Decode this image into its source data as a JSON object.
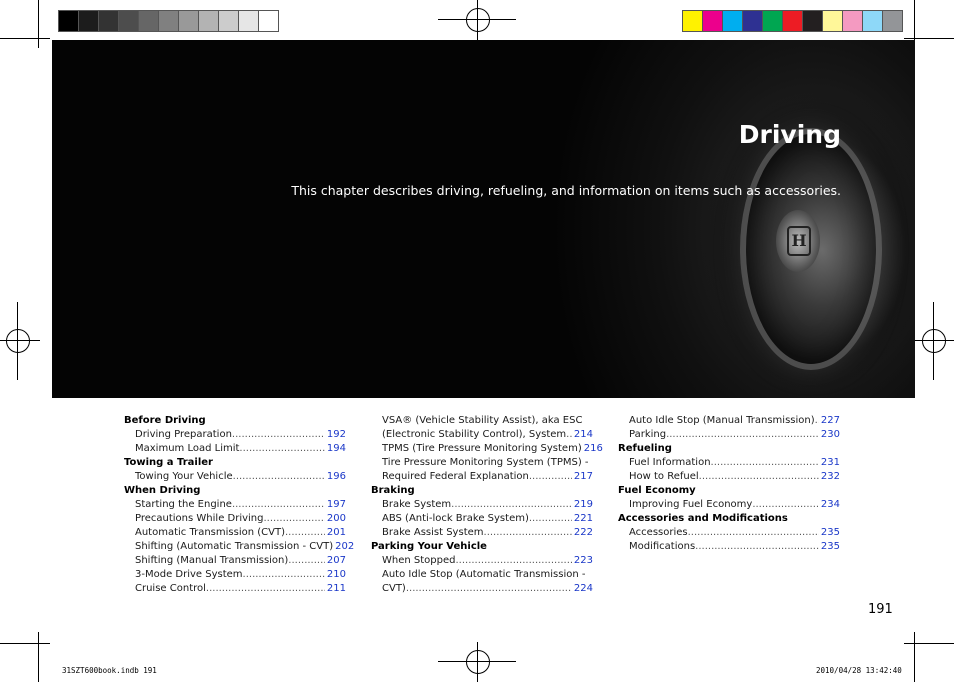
{
  "swatch_colors": {
    "gray": [
      "#000000",
      "#1c1c1c",
      "#333333",
      "#4d4d4d",
      "#666666",
      "#808080",
      "#999999",
      "#b3b3b3",
      "#cccccc",
      "#e6e6e6",
      "#ffffff"
    ],
    "process": [
      "#fff200",
      "#ec008c",
      "#00aeef",
      "#2e3192",
      "#00a651",
      "#ed1c24",
      "#231f20",
      "#fff799",
      "#f49ac1",
      "#8ed8f8",
      "#939598"
    ]
  },
  "hero": {
    "title": "Driving",
    "description": "This chapter describes driving, refueling, and information on items such as accessories.",
    "logo_glyph": "H"
  },
  "toc": {
    "col1": {
      "before_driving": "Before Driving",
      "driving_prep": {
        "label": "Driving Preparation",
        "page": "192"
      },
      "max_load": {
        "label": "Maximum Load Limit",
        "page": "194"
      },
      "towing_trailer": "Towing a Trailer",
      "towing_vehicle": {
        "label": "Towing Your Vehicle",
        "page": "196"
      },
      "when_driving": "When Driving",
      "starting_engine": {
        "label": "Starting the Engine",
        "page": "197"
      },
      "precautions": {
        "label": "Precautions While Driving",
        "page": "200"
      },
      "auto_cvt": {
        "label": "Automatic Transmission (CVT)",
        "page": "201"
      },
      "shift_auto": {
        "label": "Shifting (Automatic Transmission - CVT)",
        "page": "202"
      },
      "shift_manual": {
        "label": "Shifting (Manual Transmission)",
        "page": "207"
      },
      "three_mode": {
        "label": "3-Mode Drive System",
        "page": "210"
      },
      "cruise": {
        "label": "Cruise Control",
        "page": "211"
      }
    },
    "col2": {
      "vsa_line1": "VSA® (Vehicle Stability Assist), aka ESC",
      "vsa_line2": {
        "label": "(Electronic Stability Control), System",
        "page": "214"
      },
      "tpms1": {
        "label": "TPMS (Tire Pressure Monitoring System)",
        "page": "216"
      },
      "tpms2_line1": "Tire Pressure Monitoring System (TPMS) -",
      "tpms2_line2": {
        "label": "Required Federal Explanation",
        "page": "217"
      },
      "braking": "Braking",
      "brake_system": {
        "label": "Brake System",
        "page": "219"
      },
      "abs": {
        "label": "ABS (Anti-lock Brake System)",
        "page": "221"
      },
      "brake_assist": {
        "label": "Brake Assist System",
        "page": "222"
      },
      "parking": "Parking Your Vehicle",
      "when_stopped": {
        "label": "When Stopped",
        "page": "223"
      },
      "idle_auto_line1": "Auto Idle Stop (Automatic Transmission -",
      "idle_auto_line2": {
        "label": "CVT)",
        "page": "224"
      }
    },
    "col3": {
      "idle_manual": {
        "label": "Auto Idle Stop (Manual Transmission)",
        "page": "227"
      },
      "parking_item": {
        "label": "Parking",
        "page": "230"
      },
      "refueling": "Refueling",
      "fuel_info": {
        "label": "Fuel Information",
        "page": "231"
      },
      "how_refuel": {
        "label": "How to Refuel",
        "page": "232"
      },
      "fuel_economy": "Fuel Economy",
      "improving": {
        "label": "Improving Fuel Economy",
        "page": "234"
      },
      "acc_mods": "Accessories and Modifications",
      "accessories": {
        "label": "Accessories",
        "page": "235"
      },
      "modifications": {
        "label": "Modifications",
        "page": "235"
      }
    }
  },
  "page_number": "191",
  "footer": {
    "file": "31SZT600book.indb   191",
    "timestamp": "2010/04/28   13:42:40"
  }
}
